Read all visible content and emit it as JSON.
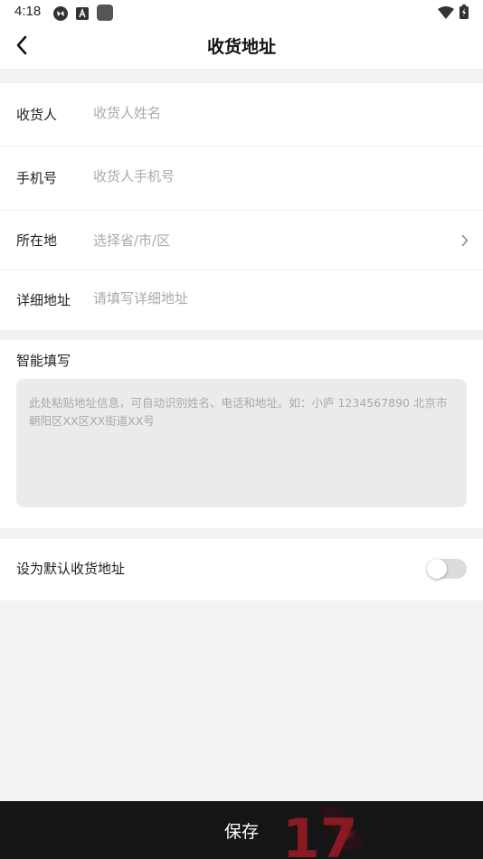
{
  "status_bar": {
    "time": "4:18"
  },
  "header": {
    "title": "收货地址"
  },
  "form": {
    "recipient": {
      "label": "收货人",
      "placeholder": "收货人姓名"
    },
    "phone": {
      "label": "手机号",
      "placeholder": "收货人手机号"
    },
    "region": {
      "label": "所在地",
      "placeholder": "选择省/市/区"
    },
    "detail": {
      "label": "详细地址",
      "placeholder": "请填写详细地址"
    }
  },
  "smart_fill": {
    "title": "智能填写",
    "placeholder": "此处粘贴地址信息，可自动识别姓名、电话和地址。如：小庐 1234567890 北京市朝阳区XX区XX街道XX号"
  },
  "default_address": {
    "label": "设为默认收货地址",
    "enabled": false
  },
  "footer": {
    "save_label": "保存"
  },
  "watermark": {
    "text": "17"
  },
  "colors": {
    "background": "#f2f2f2",
    "save_bar": "#151515",
    "toggle_off": "#dcdcdc",
    "watermark_red": "#8a1a22"
  },
  "icons": {
    "back": "chevron-left-icon",
    "region_arrow": "chevron-right-icon",
    "status_icons": [
      "refresh-icon",
      "font-app-icon",
      "square-app-icon",
      "wifi-icon",
      "battery-charging-icon"
    ]
  }
}
